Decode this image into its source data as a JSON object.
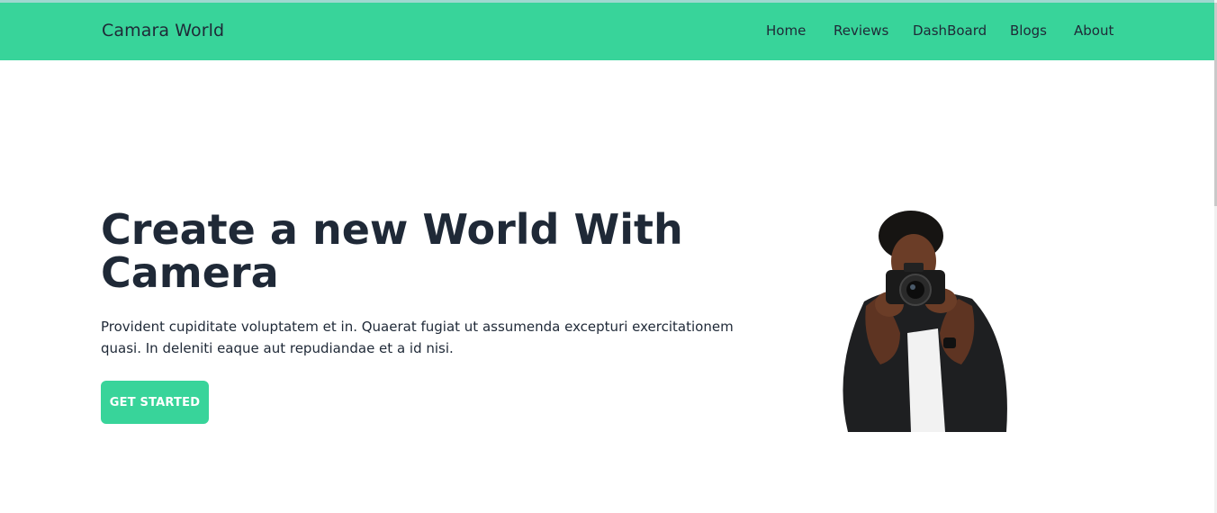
{
  "header": {
    "brand": "Camara World",
    "nav": [
      "Home",
      "Reviews",
      "DashBoard",
      "Blogs",
      "About"
    ]
  },
  "hero": {
    "title": "Create a new World With Camera",
    "text": "Provident cupiditate voluptatem et in. Quaerat fugiat ut assumenda excepturi exercitationem quasi. In deleniti eaque aut repudiandae et a id nisi.",
    "cta_label": "GET STARTED",
    "image": "photographer-with-camera"
  },
  "colors": {
    "brand_green": "#38d49a",
    "text_dark": "#1f2937",
    "button_text": "#ffffff"
  }
}
